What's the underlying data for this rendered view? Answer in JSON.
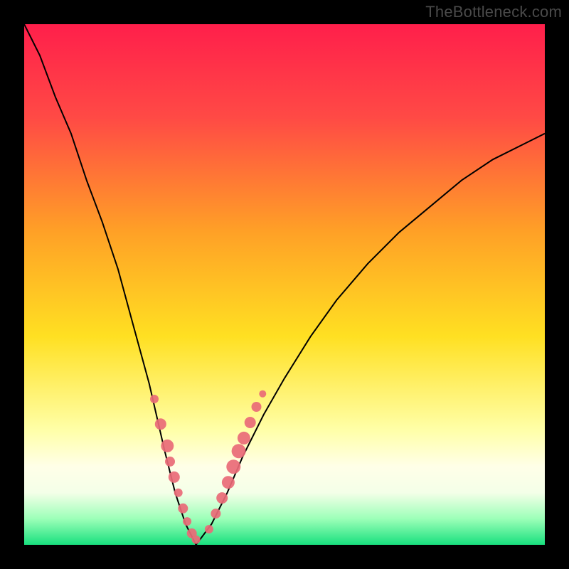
{
  "watermark": "TheBottleneck.com",
  "colors": {
    "bg_black": "#000000",
    "grad_top": "#ff1f4b",
    "grad_mid1": "#ff7a2e",
    "grad_mid2": "#ffd423",
    "grad_mid3": "#ffff60",
    "grad_mid4": "#ecffd0",
    "grad_bottom": "#18e07e",
    "curve": "#000000",
    "marker": "#e96a77"
  },
  "chart_data": {
    "type": "line",
    "title": "",
    "xlabel": "",
    "ylabel": "",
    "xlim": [
      0,
      1
    ],
    "ylim": [
      0,
      1
    ],
    "x_min_at": 0.33,
    "left_curve": [
      {
        "x": 0.0,
        "y": 1.0
      },
      {
        "x": 0.03,
        "y": 0.94
      },
      {
        "x": 0.06,
        "y": 0.86
      },
      {
        "x": 0.09,
        "y": 0.79
      },
      {
        "x": 0.12,
        "y": 0.7
      },
      {
        "x": 0.15,
        "y": 0.62
      },
      {
        "x": 0.18,
        "y": 0.53
      },
      {
        "x": 0.21,
        "y": 0.42
      },
      {
        "x": 0.24,
        "y": 0.31
      },
      {
        "x": 0.27,
        "y": 0.18
      },
      {
        "x": 0.29,
        "y": 0.1
      },
      {
        "x": 0.31,
        "y": 0.04
      },
      {
        "x": 0.33,
        "y": 0.0
      }
    ],
    "right_curve": [
      {
        "x": 0.33,
        "y": 0.0
      },
      {
        "x": 0.36,
        "y": 0.04
      },
      {
        "x": 0.39,
        "y": 0.1
      },
      {
        "x": 0.42,
        "y": 0.17
      },
      {
        "x": 0.46,
        "y": 0.25
      },
      {
        "x": 0.5,
        "y": 0.32
      },
      {
        "x": 0.55,
        "y": 0.4
      },
      {
        "x": 0.6,
        "y": 0.47
      },
      {
        "x": 0.66,
        "y": 0.54
      },
      {
        "x": 0.72,
        "y": 0.6
      },
      {
        "x": 0.78,
        "y": 0.65
      },
      {
        "x": 0.84,
        "y": 0.7
      },
      {
        "x": 0.9,
        "y": 0.74
      },
      {
        "x": 0.96,
        "y": 0.77
      },
      {
        "x": 1.0,
        "y": 0.79
      }
    ],
    "markers_left": [
      {
        "x": 0.25,
        "y": 0.28,
        "r": 6
      },
      {
        "x": 0.262,
        "y": 0.232,
        "r": 8
      },
      {
        "x": 0.275,
        "y": 0.19,
        "r": 9
      },
      {
        "x": 0.28,
        "y": 0.16,
        "r": 7
      },
      {
        "x": 0.288,
        "y": 0.13,
        "r": 8
      },
      {
        "x": 0.296,
        "y": 0.1,
        "r": 6
      },
      {
        "x": 0.305,
        "y": 0.07,
        "r": 7
      },
      {
        "x": 0.313,
        "y": 0.045,
        "r": 6
      },
      {
        "x": 0.322,
        "y": 0.022,
        "r": 7
      },
      {
        "x": 0.33,
        "y": 0.01,
        "r": 6
      }
    ],
    "markers_right": [
      {
        "x": 0.355,
        "y": 0.03,
        "r": 6
      },
      {
        "x": 0.368,
        "y": 0.06,
        "r": 7
      },
      {
        "x": 0.38,
        "y": 0.09,
        "r": 8
      },
      {
        "x": 0.392,
        "y": 0.12,
        "r": 9
      },
      {
        "x": 0.402,
        "y": 0.15,
        "r": 10
      },
      {
        "x": 0.412,
        "y": 0.18,
        "r": 10
      },
      {
        "x": 0.422,
        "y": 0.205,
        "r": 9
      },
      {
        "x": 0.434,
        "y": 0.235,
        "r": 8
      },
      {
        "x": 0.446,
        "y": 0.265,
        "r": 7
      },
      {
        "x": 0.458,
        "y": 0.29,
        "r": 5
      }
    ],
    "gradient_stops": [
      {
        "offset": 0.0,
        "color": "#ff1f4b"
      },
      {
        "offset": 0.18,
        "color": "#ff4a45"
      },
      {
        "offset": 0.4,
        "color": "#ffa126"
      },
      {
        "offset": 0.6,
        "color": "#ffe022"
      },
      {
        "offset": 0.78,
        "color": "#ffffa8"
      },
      {
        "offset": 0.85,
        "color": "#ffffe8"
      },
      {
        "offset": 0.9,
        "color": "#f4ffe8"
      },
      {
        "offset": 0.95,
        "color": "#9cffb8"
      },
      {
        "offset": 1.0,
        "color": "#18e07e"
      }
    ]
  }
}
